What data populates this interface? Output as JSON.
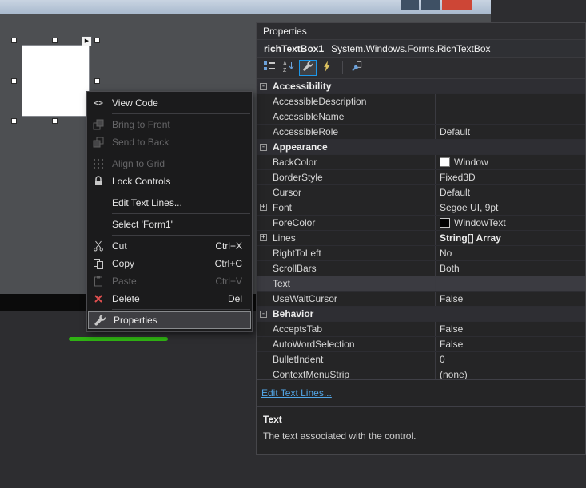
{
  "colors": {
    "annotation_green": "#2fb113",
    "close_button_red": "#cd4636",
    "link_blue": "#52a7e8",
    "delete_red": "#e04f4f",
    "toolbar_selected_border": "#1c97ea"
  },
  "icons": {
    "view_code_glyph": "<>",
    "smart_tag_glyph": "▶",
    "collapse_glyph": "-",
    "expand_glyph": "+"
  },
  "form_window": {
    "titlebar_buttons": [
      "minimize",
      "maximize",
      "close"
    ]
  },
  "context_menu": {
    "items": [
      {
        "label": "View Code",
        "icon": "view-code-icon",
        "enabled": true
      },
      {
        "label": "Bring to Front",
        "icon": "bring-to-front-icon",
        "enabled": false
      },
      {
        "label": "Send to Back",
        "icon": "send-to-back-icon",
        "enabled": false
      },
      {
        "label": "Align to Grid",
        "icon": "align-to-grid-icon",
        "enabled": false
      },
      {
        "label": "Lock Controls",
        "icon": "lock-icon",
        "enabled": true
      },
      {
        "label": "Edit Text Lines...",
        "enabled": true
      },
      {
        "label": "Select 'Form1'",
        "enabled": true
      },
      {
        "label": "Cut",
        "shortcut": "Ctrl+X",
        "icon": "cut-icon",
        "enabled": true
      },
      {
        "label": "Copy",
        "shortcut": "Ctrl+C",
        "icon": "copy-icon",
        "enabled": true
      },
      {
        "label": "Paste",
        "shortcut": "Ctrl+V",
        "icon": "paste-icon",
        "enabled": false
      },
      {
        "label": "Delete",
        "shortcut": "Del",
        "icon": "delete-icon",
        "enabled": true
      },
      {
        "label": "Properties",
        "icon": "properties-icon",
        "enabled": true,
        "highlighted": true
      }
    ]
  },
  "properties_panel": {
    "title": "Properties",
    "object_selector": {
      "name": "richTextBox1",
      "type": "System.Windows.Forms.RichTextBox"
    },
    "toolbar": [
      "categorized",
      "alphabetical",
      "properties",
      "events",
      "property-pages"
    ],
    "grid": {
      "rows": [
        {
          "kind": "category",
          "label": "Accessibility"
        },
        {
          "kind": "property",
          "name": "AccessibleDescription",
          "value": ""
        },
        {
          "kind": "property",
          "name": "AccessibleName",
          "value": ""
        },
        {
          "kind": "property",
          "name": "AccessibleRole",
          "value": "Default"
        },
        {
          "kind": "category",
          "label": "Appearance"
        },
        {
          "kind": "property",
          "name": "BackColor",
          "value": "Window",
          "swatch": "#ffffff"
        },
        {
          "kind": "property",
          "name": "BorderStyle",
          "value": "Fixed3D"
        },
        {
          "kind": "property",
          "name": "Cursor",
          "value": "Default"
        },
        {
          "kind": "property",
          "name": "Font",
          "value": "Segoe UI, 9pt",
          "expandable": true
        },
        {
          "kind": "property",
          "name": "ForeColor",
          "value": "WindowText",
          "swatch": "#000000"
        },
        {
          "kind": "property",
          "name": "Lines",
          "value": "String[] Array",
          "expandable": true,
          "bold_value": true
        },
        {
          "kind": "property",
          "name": "RightToLeft",
          "value": "No"
        },
        {
          "kind": "property",
          "name": "ScrollBars",
          "value": "Both"
        },
        {
          "kind": "property",
          "name": "Text",
          "value": "",
          "selected": true
        },
        {
          "kind": "property",
          "name": "UseWaitCursor",
          "value": "False"
        },
        {
          "kind": "category",
          "label": "Behavior"
        },
        {
          "kind": "property",
          "name": "AcceptsTab",
          "value": "False"
        },
        {
          "kind": "property",
          "name": "AutoWordSelection",
          "value": "False"
        },
        {
          "kind": "property",
          "name": "BulletIndent",
          "value": "0"
        },
        {
          "kind": "property",
          "name": "ContextMenuStrip",
          "value": "(none)"
        }
      ]
    },
    "command_link": "Edit Text Lines...",
    "description": {
      "title": "Text",
      "text": "The text associated with the control."
    }
  }
}
